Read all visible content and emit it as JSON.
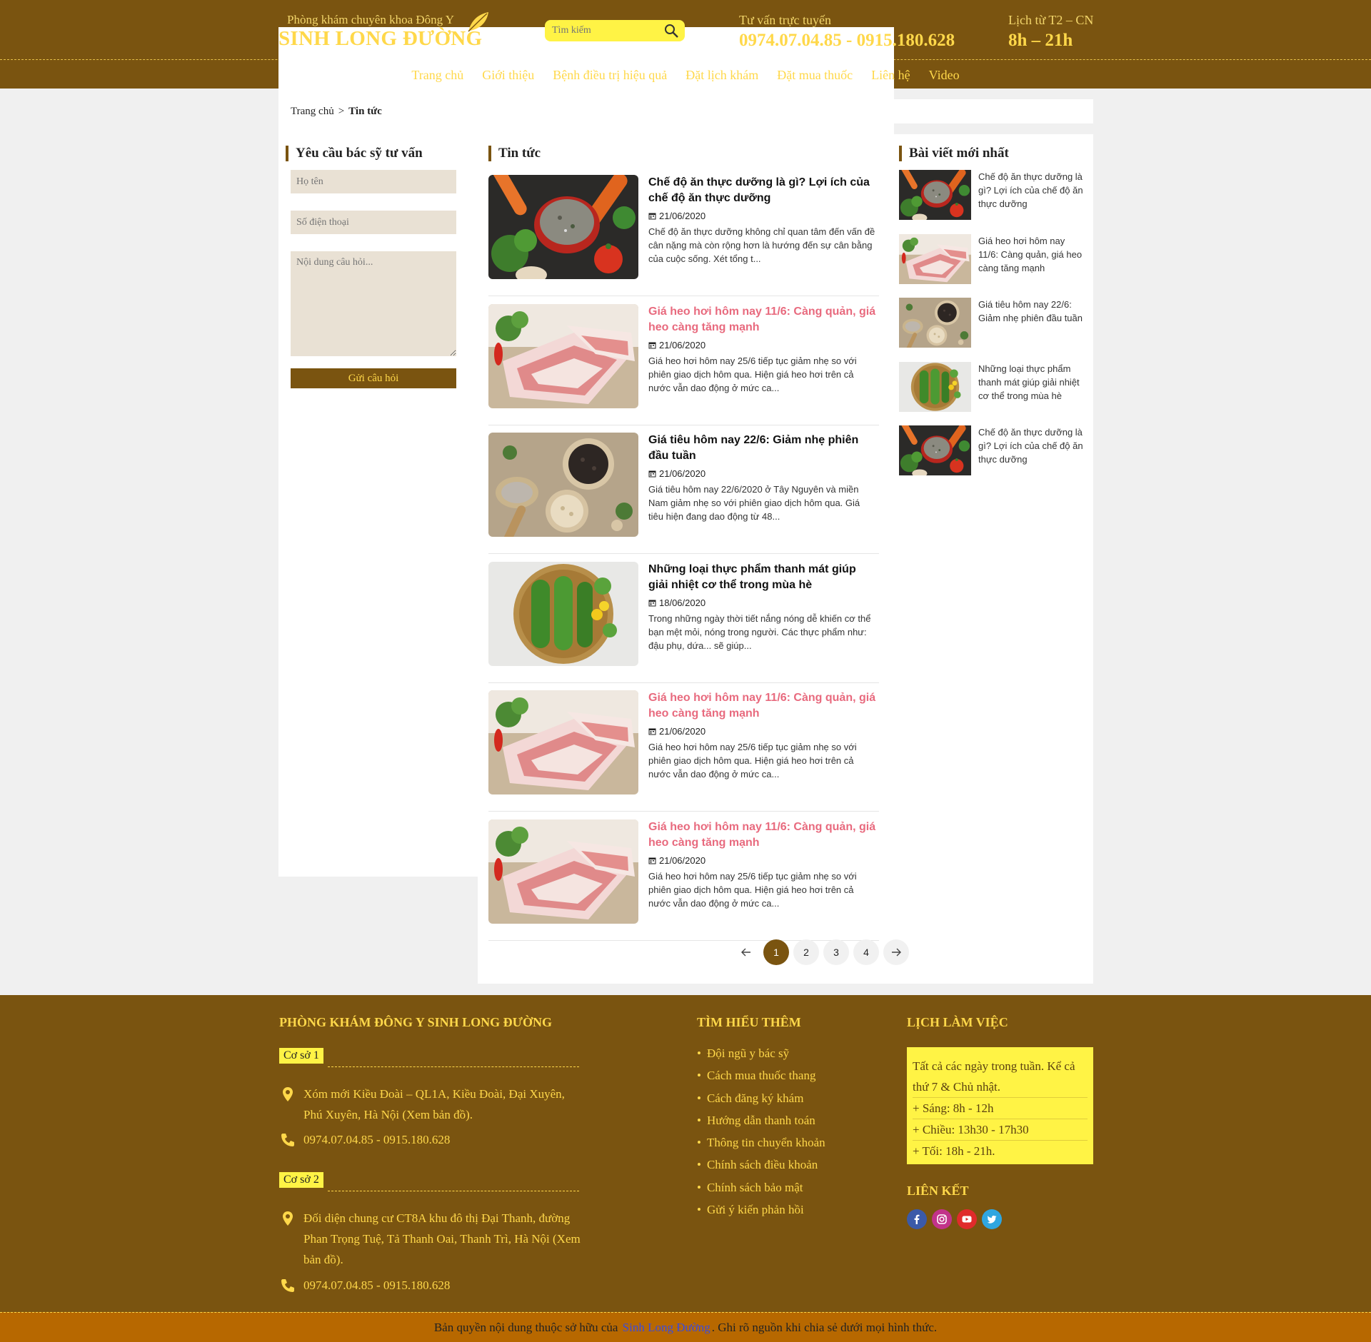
{
  "header": {
    "logo_sub": "Phòng khám chuyên khoa Đông Y",
    "logo_main": "SINH LONG ĐƯỜNG",
    "search_placeholder": "Tìm kiếm",
    "hotline_label": "Tư vấn trực tuyến",
    "hotline_value": "0974.07.04.85 - 0915.180.628",
    "hours_label": "Lịch từ T2 – CN",
    "hours_value": "8h – 21h",
    "nav": [
      "Trang chủ",
      "Giới thiệu",
      "Bệnh điều trị hiệu quả",
      "Đặt lịch khám",
      "Đặt mua thuốc",
      "Liên hệ",
      "Video"
    ]
  },
  "breadcrumb": {
    "home": "Trang chủ",
    "sep": ">",
    "current": "Tin tức"
  },
  "consult": {
    "title": "Yêu cầu bác sỹ tư vấn",
    "name_placeholder": "Họ tên",
    "phone_placeholder": "Số điện thoại",
    "question_placeholder": "Nội dung câu hỏi...",
    "submit": "Gửi câu hỏi"
  },
  "news": {
    "title": "Tin tức",
    "posts": [
      {
        "title": "Chế độ ăn thực dưỡng là gì? Lợi ích của chế độ ăn thực dưỡng",
        "date": "21/06/2020",
        "excerpt": "Chế độ ăn thực dưỡng không chỉ quan tâm đến vấn đề cân nặng mà còn rộng hơn là hướng đến sự cân bằng của cuộc sống. Xét tổng t...",
        "image": "vegetables",
        "highlight": false
      },
      {
        "title": "Giá heo hơi hôm nay 11/6: Càng quản, giá heo càng tăng mạnh",
        "date": "21/06/2020",
        "excerpt": "Giá heo hơi hôm nay 25/6 tiếp tục giảm nhẹ so với phiên giao dịch hôm qua. Hiện giá heo hơi trên cả nước vẫn dao động ở mức ca...",
        "image": "pork",
        "highlight": true
      },
      {
        "title": "Giá tiêu hôm nay 22/6: Giảm nhẹ phiên đầu tuần",
        "date": "21/06/2020",
        "excerpt": "Giá tiêu hôm nay 22/6/2020 ở Tây Nguyên và miền Nam giảm nhẹ so với phiên giao dịch hôm qua. Giá tiêu hiện đang dao động từ 48...",
        "image": "pepper",
        "highlight": false
      },
      {
        "title": "Những loại thực phẩm thanh mát giúp giải nhiệt cơ thể trong mùa hè",
        "date": "18/06/2020",
        "excerpt": "Trong những ngày thời tiết nắng nóng dễ khiến cơ thể bạn mệt mỏi, nóng trong người. Các thực phẩm như: đậu phụ, dứa... sẽ giúp...",
        "image": "cucumber",
        "highlight": false
      },
      {
        "title": "Giá heo hơi hôm nay 11/6: Càng quản, giá heo càng tăng mạnh",
        "date": "21/06/2020",
        "excerpt": "Giá heo hơi hôm nay 25/6 tiếp tục giảm nhẹ so với phiên giao dịch hôm qua. Hiện giá heo hơi trên cả nước vẫn dao động ở mức ca...",
        "image": "pork",
        "highlight": true
      },
      {
        "title": "Giá heo hơi hôm nay 11/6: Càng quản, giá heo càng tăng mạnh",
        "date": "21/06/2020",
        "excerpt": "Giá heo hơi hôm nay 25/6 tiếp tục giảm nhẹ so với phiên giao dịch hôm qua. Hiện giá heo hơi trên cả nước vẫn dao động ở mức ca...",
        "image": "pork",
        "highlight": true
      }
    ],
    "pages": [
      "1",
      "2",
      "3",
      "4"
    ],
    "active_page": "1"
  },
  "latest": {
    "title": "Bài viết mới nhất",
    "items": [
      {
        "title": "Chế độ ăn thực dưỡng là gì? Lợi ích của chế độ ăn thực dưỡng",
        "image": "vegetables"
      },
      {
        "title": "Giá heo hơi hôm nay 11/6: Càng quản, giá heo càng tăng mạnh",
        "image": "pork"
      },
      {
        "title": "Giá tiêu hôm nay 22/6: Giảm nhẹ phiên đầu tuần",
        "image": "pepper"
      },
      {
        "title": "Những loại thực phẩm thanh mát giúp giải nhiệt cơ thể trong mùa hè",
        "image": "cucumber"
      },
      {
        "title": "Chế độ ăn thực dưỡng là gì? Lợi ích của chế độ ăn thực dưỡng",
        "image": "vegetables"
      }
    ]
  },
  "footer": {
    "clinic_title": "PHÒNG KHÁM ĐÔNG Y SINH LONG ĐƯỜNG",
    "branch1": {
      "label": "Cơ sở 1",
      "address": "Xóm mới Kiều Đoài – QL1A, Kiều Đoài, Đại Xuyên, Phú Xuyên, Hà Nội (Xem bản đồ).",
      "phone": "0974.07.04.85 - 0915.180.628"
    },
    "branch2": {
      "label": "Cơ sở 2",
      "address": "Đối diện chung cư CT8A khu đô thị Đại Thanh, đường Phan Trọng Tuệ, Tả Thanh Oai, Thanh Trì, Hà Nội (Xem bản đồ).",
      "phone": "0974.07.04.85 - 0915.180.628"
    },
    "learn_title": "TÌM HIỂU THÊM",
    "learn_links": [
      "Đội ngũ y bác sỹ",
      "Cách mua thuốc thang",
      "Cách đăng ký khám",
      "Hướng dẫn thanh toán",
      "Thông tin chuyển khoản",
      "Chính sách điều khoản",
      "Chính sách bảo mật",
      "Gửi ý kiến phản hồi"
    ],
    "schedule_title": "LỊCH LÀM VIỆC",
    "schedule": [
      "Tất cả các ngày trong tuần. Kể cả thứ 7 & Chủ nhật.",
      "+ Sáng: 8h - 12h",
      "+ Chiều: 13h30 - 17h30",
      "+ Tối: 18h - 21h."
    ],
    "social_title": "LIÊN KẾT",
    "social": [
      "facebook-icon",
      "instagram-icon",
      "youtube-icon",
      "twitter-icon"
    ],
    "copyright_pre": "Bản quyền nội dung thuộc sở hữu của",
    "copyright_brand": "Sinh Long Đường",
    "copyright_post": ". Ghi rõ nguồn khi chia sẻ dưới mọi hình thức."
  },
  "colors": {
    "brand": "#7a5410",
    "accent": "#ffd84a",
    "highlight": "#fff345",
    "pink": "#e86a7e"
  }
}
